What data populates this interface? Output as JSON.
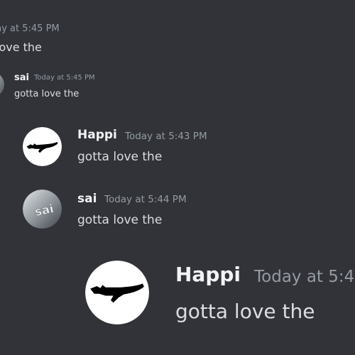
{
  "colors": {
    "background": "#313338",
    "author": "#f2f3f5",
    "timestamp": "#949ba4",
    "content": "#dbdee1"
  },
  "messages": [
    {
      "author": "",
      "timestamp": "day at 5:45 PM",
      "content": "love the",
      "avatar_icon": ""
    },
    {
      "author": "sai",
      "timestamp": "Today at 5:45 PM",
      "content": "gotta love the",
      "avatar_icon": "sai-avatar-icon"
    },
    {
      "author": "Happi",
      "timestamp": "Today at 5:43 PM",
      "content": "gotta love the",
      "avatar_icon": "dog-silhouette-avatar-icon"
    },
    {
      "author": "sai",
      "timestamp": "Today at 5:44 PM",
      "content": "gotta love the",
      "avatar_icon": "sai-avatar-icon"
    },
    {
      "author": "Happi",
      "timestamp": "Today at 5:4",
      "content": "gotta love the",
      "avatar_icon": "dog-silhouette-avatar-icon"
    }
  ]
}
